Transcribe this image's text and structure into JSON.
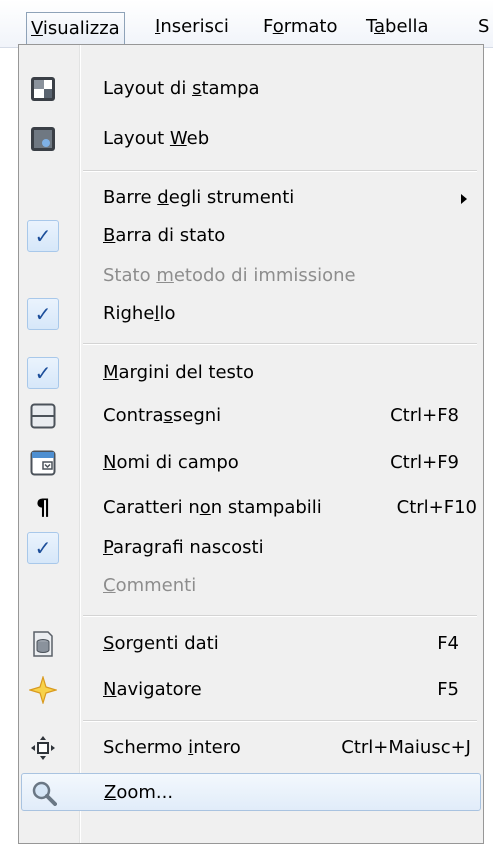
{
  "menubar": {
    "items": [
      {
        "pre": "",
        "key": "V",
        "post": "isualizza"
      },
      {
        "pre": "",
        "key": "I",
        "post": "nserisci"
      },
      {
        "pre": "F",
        "key": "o",
        "post": "rmato"
      },
      {
        "pre": "T",
        "key": "a",
        "post": "bella"
      },
      {
        "pre": "",
        "key": "",
        "post": "S"
      }
    ]
  },
  "menu": {
    "items": [
      {
        "pre": "Layout di ",
        "key": "s",
        "post": "tampa",
        "shortcut": "",
        "icon": "print-layout-icon"
      },
      {
        "pre": "Layout ",
        "key": "W",
        "post": "eb",
        "shortcut": "",
        "icon": "web-layout-icon"
      },
      {
        "pre": "Barre ",
        "key": "d",
        "post": "egli strumenti",
        "shortcut": ""
      },
      {
        "pre": "",
        "key": "B",
        "post": "arra di stato",
        "shortcut": "",
        "checked": "✓"
      },
      {
        "pre": "Stato ",
        "key": "m",
        "post": "etodo di immissione",
        "shortcut": ""
      },
      {
        "pre": "Righe",
        "key": "l",
        "post": "lo",
        "shortcut": "",
        "checked": "✓"
      },
      {
        "pre": "",
        "key": "M",
        "post": "argini del testo",
        "shortcut": "",
        "checked": "✓"
      },
      {
        "pre": "Contra",
        "key": "s",
        "post": "segni",
        "shortcut": "Ctrl+F8",
        "icon": "bookmarks-icon"
      },
      {
        "pre": "",
        "key": "N",
        "post": "omi di campo",
        "shortcut": "Ctrl+F9",
        "icon": "field-names-icon"
      },
      {
        "pre": "Caratteri n",
        "key": "o",
        "post": "n stampabili",
        "shortcut": "Ctrl+F10",
        "icon": "pilcrow-icon",
        "glyph": "¶"
      },
      {
        "pre": "",
        "key": "P",
        "post": "aragrafi nascosti",
        "shortcut": "",
        "checked": "✓"
      },
      {
        "pre": "",
        "key": "C",
        "post": "ommenti",
        "shortcut": ""
      },
      {
        "pre": "",
        "key": "S",
        "post": "orgenti dati",
        "shortcut": "F4",
        "icon": "data-sources-icon"
      },
      {
        "pre": "",
        "key": "N",
        "post": "avigatore",
        "shortcut": "F5",
        "icon": "navigator-icon"
      },
      {
        "pre": "Schermo ",
        "key": "i",
        "post": "ntero",
        "shortcut": "Ctrl+Maiusc+J",
        "icon": "full-screen-icon"
      },
      {
        "pre": "",
        "key": "Z",
        "post": "oom...",
        "shortcut": "",
        "icon": "zoom-icon"
      }
    ]
  },
  "colors": {
    "menu_bg": "#f0f0f0",
    "check_bg": "#d6e7f9",
    "check_border": "#a8c8ea",
    "hover_bg": "#e1ecf9",
    "disabled_text": "#8d8d8d"
  }
}
